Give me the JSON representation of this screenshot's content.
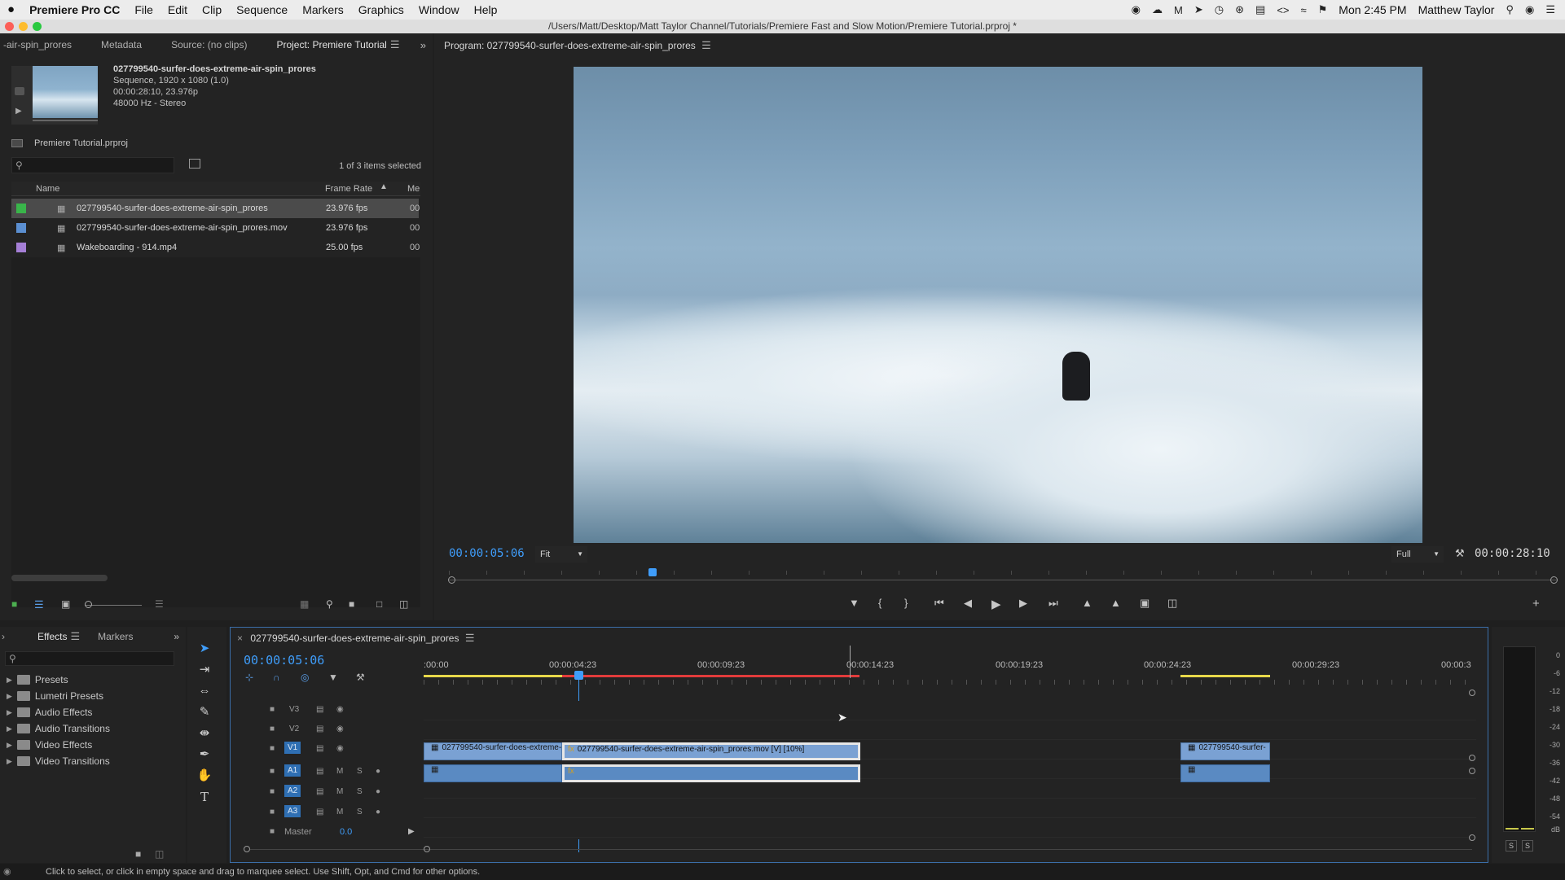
{
  "menubar": {
    "app": "Premiere Pro CC",
    "items": [
      "File",
      "Edit",
      "Clip",
      "Sequence",
      "Markers",
      "Graphics",
      "Window",
      "Help"
    ],
    "clock": "Mon 2:45 PM",
    "user": "Matthew Taylor"
  },
  "window": {
    "title": "/Users/Matt/Desktop/Matt Taylor Channel/Tutorials/Premiere Fast and Slow Motion/Premiere Tutorial.prproj *"
  },
  "project_panel": {
    "tabs": [
      "-air-spin_prores",
      "Metadata",
      "Source: (no clips)",
      "Project: Premiere Tutorial"
    ],
    "preview": {
      "name": "027799540-surfer-does-extreme-air-spin_prores",
      "line1": "Sequence, 1920 x 1080 (1.0)",
      "line2": "00:00:28:10, 23.976p",
      "line3": "48000 Hz - Stereo"
    },
    "project_file": "Premiere Tutorial.prproj",
    "selection_status": "1 of 3 items selected",
    "columns": {
      "name": "Name",
      "frame_rate": "Frame Rate",
      "media": "Me"
    },
    "items": [
      {
        "name": "027799540-surfer-does-extreme-air-spin_prores",
        "frame_rate": "23.976 fps",
        "media": "00",
        "color": "#39b54a",
        "selected": true
      },
      {
        "name": "027799540-surfer-does-extreme-air-spin_prores.mov",
        "frame_rate": "23.976 fps",
        "media": "00",
        "color": "#5b8fd1",
        "selected": false
      },
      {
        "name": "Wakeboarding - 914.mp4",
        "frame_rate": "25.00 fps",
        "media": "00",
        "color": "#a57fd6",
        "selected": false
      }
    ]
  },
  "program_monitor": {
    "title": "Program: 027799540-surfer-does-extreme-air-spin_prores",
    "timecode": "00:00:05:06",
    "zoom": "Fit",
    "resolution": "Full",
    "duration": "00:00:28:10",
    "playhead_fraction": 0.184
  },
  "effects_panel": {
    "tabs": [
      "Effects",
      "Markers"
    ],
    "items": [
      "Presets",
      "Lumetri Presets",
      "Audio Effects",
      "Audio Transitions",
      "Video Effects",
      "Video Transitions"
    ]
  },
  "timeline": {
    "sequence_name": "027799540-surfer-does-extreme-air-spin_prores",
    "timecode": "00:00:05:06",
    "ruler_labels": [
      ":00:00",
      "00:00:04:23",
      "00:00:09:23",
      "00:00:14:23",
      "00:00:19:23",
      "00:00:24:23",
      "00:00:29:23",
      "00:00:3"
    ],
    "tracks": {
      "video": [
        "V3",
        "V2",
        "V1"
      ],
      "audio": [
        "A1",
        "A2",
        "A3"
      ],
      "master": "Master",
      "master_value": "0.0",
      "mute": "M",
      "solo": "S"
    },
    "clips": {
      "v1a": "027799540-surfer-does-extreme-",
      "v1b": "027799540-surfer-does-extreme-air-spin_prores.mov [V] [10%]",
      "v1c": "027799540-surfer-",
      "fx": "fx"
    }
  },
  "audio_meter": {
    "labels": [
      "0",
      "-6",
      "-12",
      "-18",
      "-24",
      "-30",
      "-36",
      "-42",
      "-48",
      "-54",
      "dB"
    ],
    "solo_left": "S",
    "solo_right": "S"
  },
  "status_bar": {
    "text": "Click to select, or click in empty space and drag to marquee select. Use Shift, Opt, and Cmd for other options."
  }
}
